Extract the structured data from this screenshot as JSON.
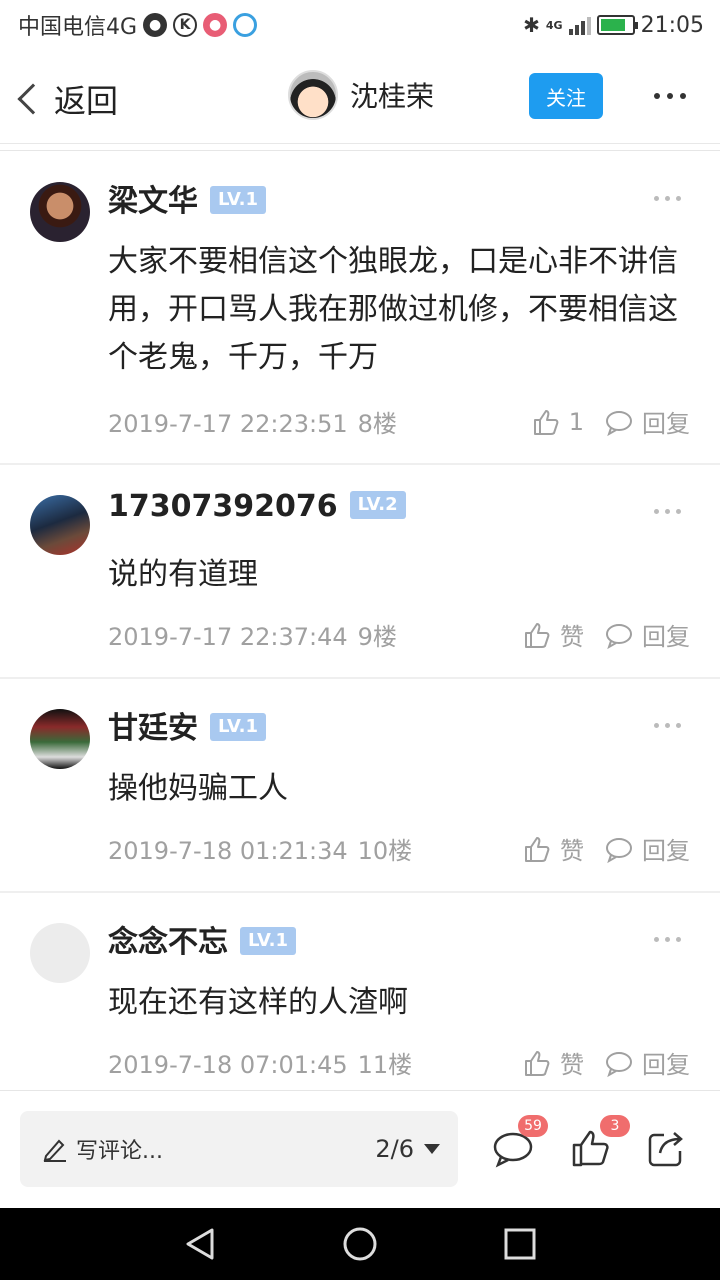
{
  "status_bar": {
    "carrier": "中国电信4G",
    "network_small": "4G",
    "time": "21:05",
    "battery_color": "#2bb24c"
  },
  "nav": {
    "back_label": "返回",
    "username": "沈桂荣",
    "follow_label": "关注",
    "follow_color": "#1e9cf0"
  },
  "comments": [
    {
      "name": "梁文华",
      "level": "LV.1",
      "text": "大家不要相信这个独眼龙，口是心非不讲信用，开口骂人我在那做过机修，不要相信这个老鬼，千万，千万",
      "date": "2019-7-17 22:23:51",
      "floor": "8楼",
      "like": "1",
      "reply": "回复"
    },
    {
      "name": "17307392076",
      "level": "LV.2",
      "text": "说的有道理",
      "date": "2019-7-17 22:37:44",
      "floor": "9楼",
      "like": "赞",
      "reply": "回复"
    },
    {
      "name": "甘廷安",
      "level": "LV.1",
      "text": "操他妈骗工人",
      "date": "2019-7-18 01:21:34",
      "floor": "10楼",
      "like": "赞",
      "reply": "回复"
    },
    {
      "name": "念念不忘",
      "level": "LV.1",
      "text": "现在还有这样的人渣啊",
      "date": "2019-7-18 07:01:45",
      "floor": "11楼",
      "like": "赞",
      "reply": "回复"
    }
  ],
  "bottom_bar": {
    "write_placeholder": "写评论...",
    "page_indicator": "2/6",
    "comment_count": "59",
    "like_count": "3",
    "badge_color": "#f06d6d"
  }
}
